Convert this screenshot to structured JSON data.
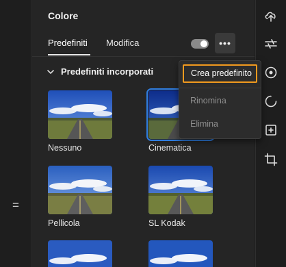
{
  "panel": {
    "title": "Colore",
    "tabs": [
      {
        "label": "Predefiniti",
        "active": true
      },
      {
        "label": "Modifica",
        "active": false
      }
    ],
    "toggle_on": true,
    "more_label": "•••"
  },
  "section": {
    "title": "Predefiniti incorporati",
    "expanded": true
  },
  "presets": [
    {
      "label": "Nessuno",
      "selected": false
    },
    {
      "label": "Cinematica",
      "selected": true
    },
    {
      "label": "Pellicola",
      "selected": false
    },
    {
      "label": "SL Kodak",
      "selected": false
    }
  ],
  "dropdown": {
    "items": [
      {
        "label": "Crea predefinito",
        "enabled": true
      },
      {
        "label": "Rinomina",
        "enabled": false
      },
      {
        "label": "Elimina",
        "enabled": false
      }
    ]
  },
  "left_strip": {
    "grip_glyph": "="
  },
  "right_rail": {
    "icons": [
      "cloud-upload-icon",
      "adjust-sliders-icon",
      "color-wheel-icon",
      "effects-icon",
      "add-frame-icon",
      "crop-icon"
    ]
  },
  "colors": {
    "accent_orange": "#f29a1e",
    "selection_blue": "#2f7de0",
    "panel_bg": "#252525"
  }
}
